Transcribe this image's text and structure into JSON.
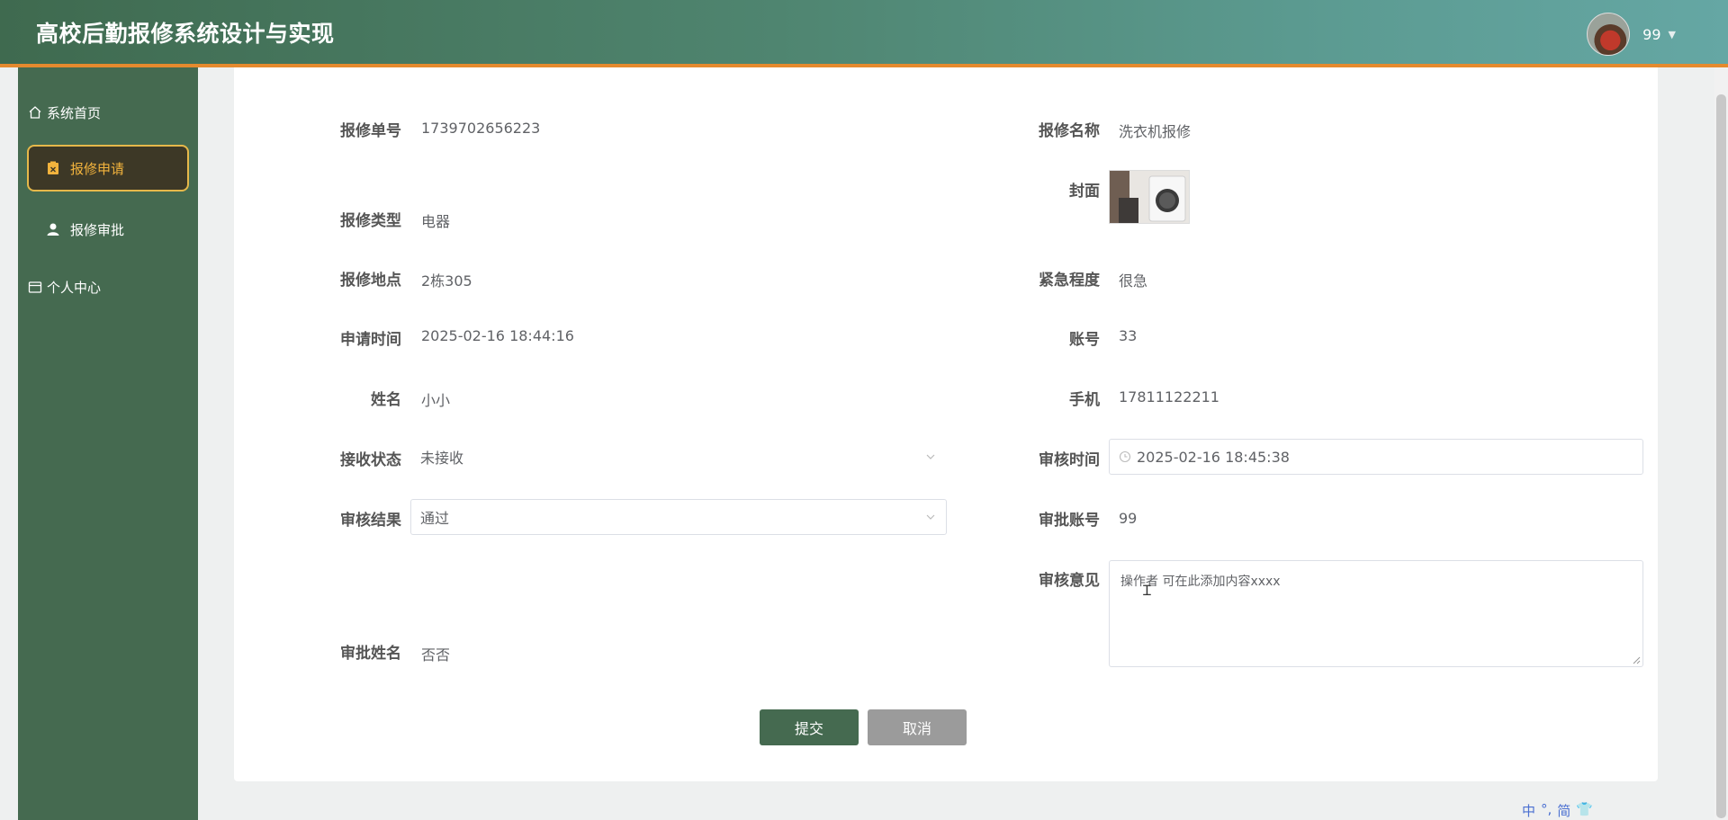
{
  "header": {
    "title": "高校后勤报修系统设计与实现",
    "user_name": "99",
    "colors": {
      "accent_line": "#e58a2e",
      "primary": "#456a50"
    }
  },
  "sidebar": {
    "items": [
      {
        "label": "系统首页",
        "icon": "home-icon"
      },
      {
        "label": "报修申请",
        "icon": "repair-doc-icon",
        "active": true
      },
      {
        "label": "报修审批",
        "icon": "user-icon"
      },
      {
        "label": "个人中心",
        "icon": "wallet-icon"
      }
    ]
  },
  "form": {
    "repair_no": {
      "label": "报修单号",
      "value": "1739702656223"
    },
    "repair_name": {
      "label": "报修名称",
      "value": "洗衣机报修"
    },
    "cover": {
      "label": "封面"
    },
    "repair_type": {
      "label": "报修类型",
      "value": "电器"
    },
    "location": {
      "label": "报修地点",
      "value": "2栋305"
    },
    "urgency": {
      "label": "紧急程度",
      "value": "很急"
    },
    "apply_time": {
      "label": "申请时间",
      "value": "2025-02-16 18:44:16"
    },
    "account": {
      "label": "账号",
      "value": "33"
    },
    "name": {
      "label": "姓名",
      "value": "小小"
    },
    "phone": {
      "label": "手机",
      "value": "17811122211"
    },
    "receive_status": {
      "label": "接收状态",
      "value": "未接收"
    },
    "review_time": {
      "label": "审核时间",
      "value": "2025-02-16 18:45:38"
    },
    "review_result": {
      "label": "审核结果",
      "value": "通过"
    },
    "approver_account": {
      "label": "审批账号",
      "value": "99"
    },
    "review_opinion": {
      "label": "审核意见",
      "value": "操作者 可在此添加内容xxxx"
    },
    "approver_name": {
      "label": "审批姓名",
      "value": "否否"
    }
  },
  "buttons": {
    "submit": "提交",
    "cancel": "取消"
  },
  "ime": [
    "中",
    "°,",
    "简",
    "👕"
  ]
}
